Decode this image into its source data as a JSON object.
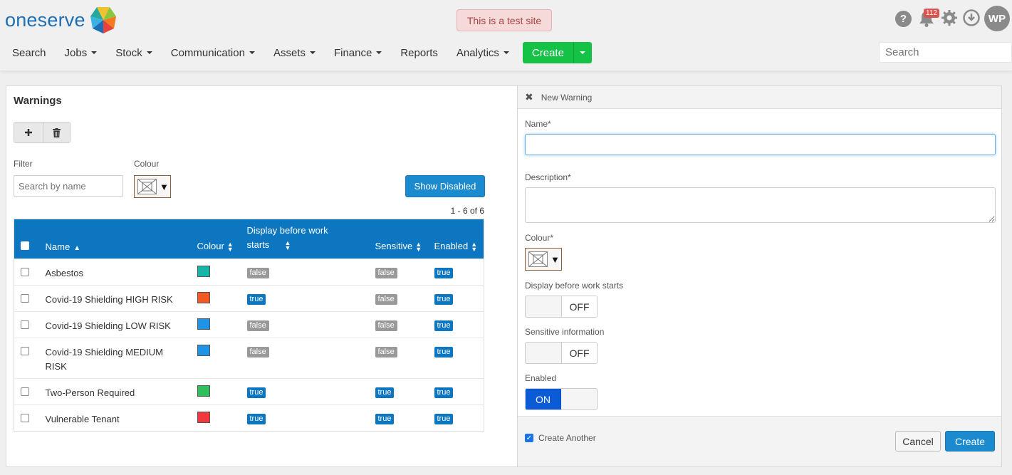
{
  "brand": {
    "name": "oneserve"
  },
  "banner": "This is a test site",
  "top_icons": {
    "help": "?",
    "notifications_count": "112",
    "avatar_initials": "WP"
  },
  "nav": {
    "items": [
      "Search",
      "Jobs",
      "Stock",
      "Communication",
      "Assets",
      "Finance",
      "Reports",
      "Analytics"
    ],
    "create_label": "Create",
    "search_placeholder": "Search"
  },
  "warnings": {
    "title": "Warnings",
    "filter_label": "Filter",
    "filter_placeholder": "Search by name",
    "colour_label": "Colour",
    "show_disabled_label": "Show Disabled",
    "pager": "1 - 6 of 6",
    "columns": {
      "name": "Name",
      "colour": "Colour",
      "display_before": "Display before work starts",
      "sensitive": "Sensitive",
      "enabled": "Enabled"
    },
    "rows": [
      {
        "name": "Asbestos",
        "colour": "#15b5a8",
        "display": "false",
        "sensitive": "false",
        "enabled": "true"
      },
      {
        "name": "Covid-19 Shielding HIGH RISK",
        "colour": "#f25a22",
        "display": "true",
        "sensitive": "false",
        "enabled": "true"
      },
      {
        "name": "Covid-19 Shielding LOW RISK",
        "colour": "#1f93e6",
        "display": "false",
        "sensitive": "false",
        "enabled": "true"
      },
      {
        "name": "Covid-19 Shielding MEDIUM RISK",
        "colour": "#1f93e6",
        "display": "false",
        "sensitive": "false",
        "enabled": "true"
      },
      {
        "name": "Two-Person Required",
        "colour": "#2fbf5b",
        "display": "true",
        "sensitive": "true",
        "enabled": "true"
      },
      {
        "name": "Vulnerable Tenant",
        "colour": "#f2383d",
        "display": "true",
        "sensitive": "true",
        "enabled": "true"
      }
    ]
  },
  "new_warning": {
    "title": "New Warning",
    "name_label": "Name*",
    "name_value": "",
    "description_label": "Description*",
    "description_value": "",
    "colour_label": "Colour*",
    "display_label": "Display before work starts",
    "display_state": "OFF",
    "sensitive_label": "Sensitive information",
    "sensitive_state": "OFF",
    "enabled_label": "Enabled",
    "enabled_state": "ON",
    "create_another_label": "Create Another",
    "create_another_checked": true,
    "cancel_label": "Cancel",
    "create_label": "Create"
  }
}
